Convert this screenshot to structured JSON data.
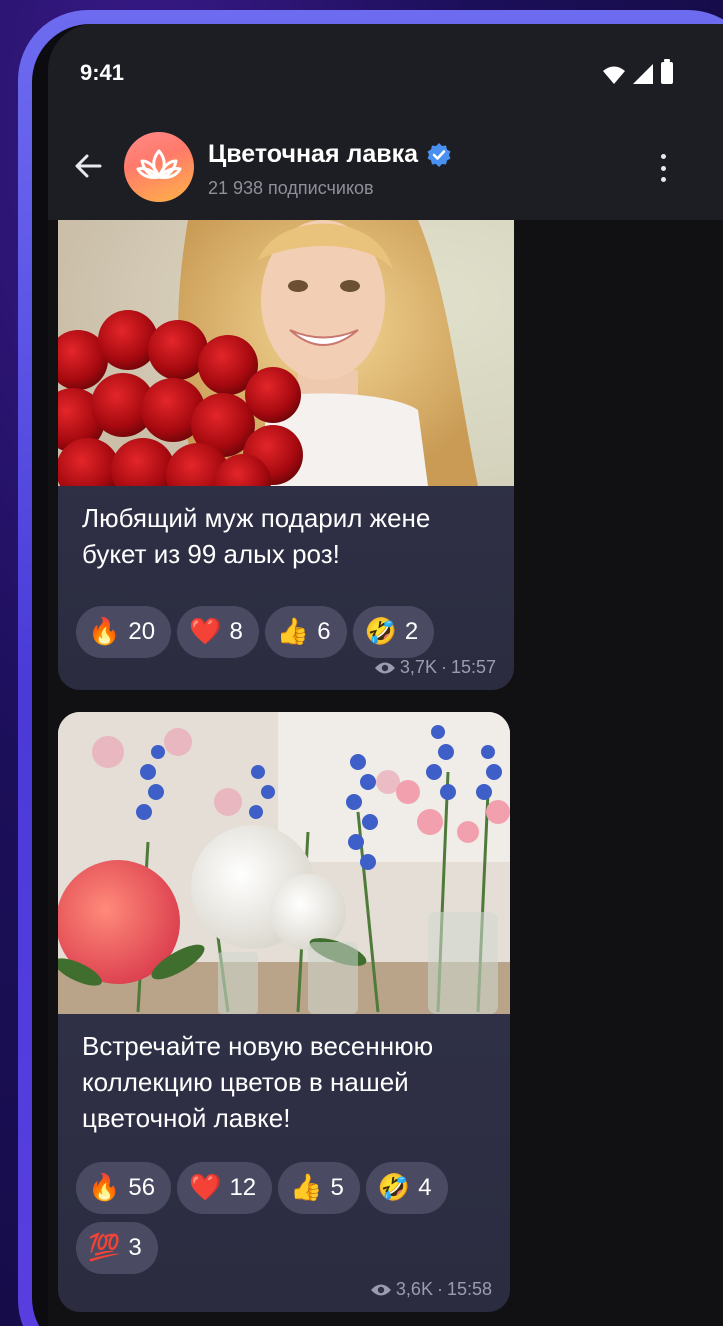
{
  "status_bar": {
    "time": "9:41"
  },
  "header": {
    "channel_name": "Цветочная лавка",
    "subscribers": "21 938 подписчиков"
  },
  "posts": [
    {
      "caption": "Любящий муж подарил жене букет из 99 алых роз!",
      "reactions": [
        {
          "emoji": "🔥",
          "count": "20"
        },
        {
          "emoji": "❤️",
          "count": "8"
        },
        {
          "emoji": "👍",
          "count": "6"
        },
        {
          "emoji": "🤣",
          "count": "2"
        }
      ],
      "views": "3,7K",
      "time": "15:57"
    },
    {
      "caption": "Встречайте новую весеннюю коллекцию цветов в нашей цветочной лавке!",
      "reactions": [
        {
          "emoji": "🔥",
          "count": "56"
        },
        {
          "emoji": "❤️",
          "count": "12"
        },
        {
          "emoji": "👍",
          "count": "5"
        },
        {
          "emoji": "🤣",
          "count": "4"
        },
        {
          "emoji": "💯",
          "count": "3"
        }
      ],
      "views": "3,6K",
      "time": "15:58"
    }
  ],
  "colors": {
    "accent": "#4a90f0",
    "background": "#111114",
    "header": "#1d1e23",
    "bubble": "#2f3046",
    "chip": "#4a4b62"
  }
}
